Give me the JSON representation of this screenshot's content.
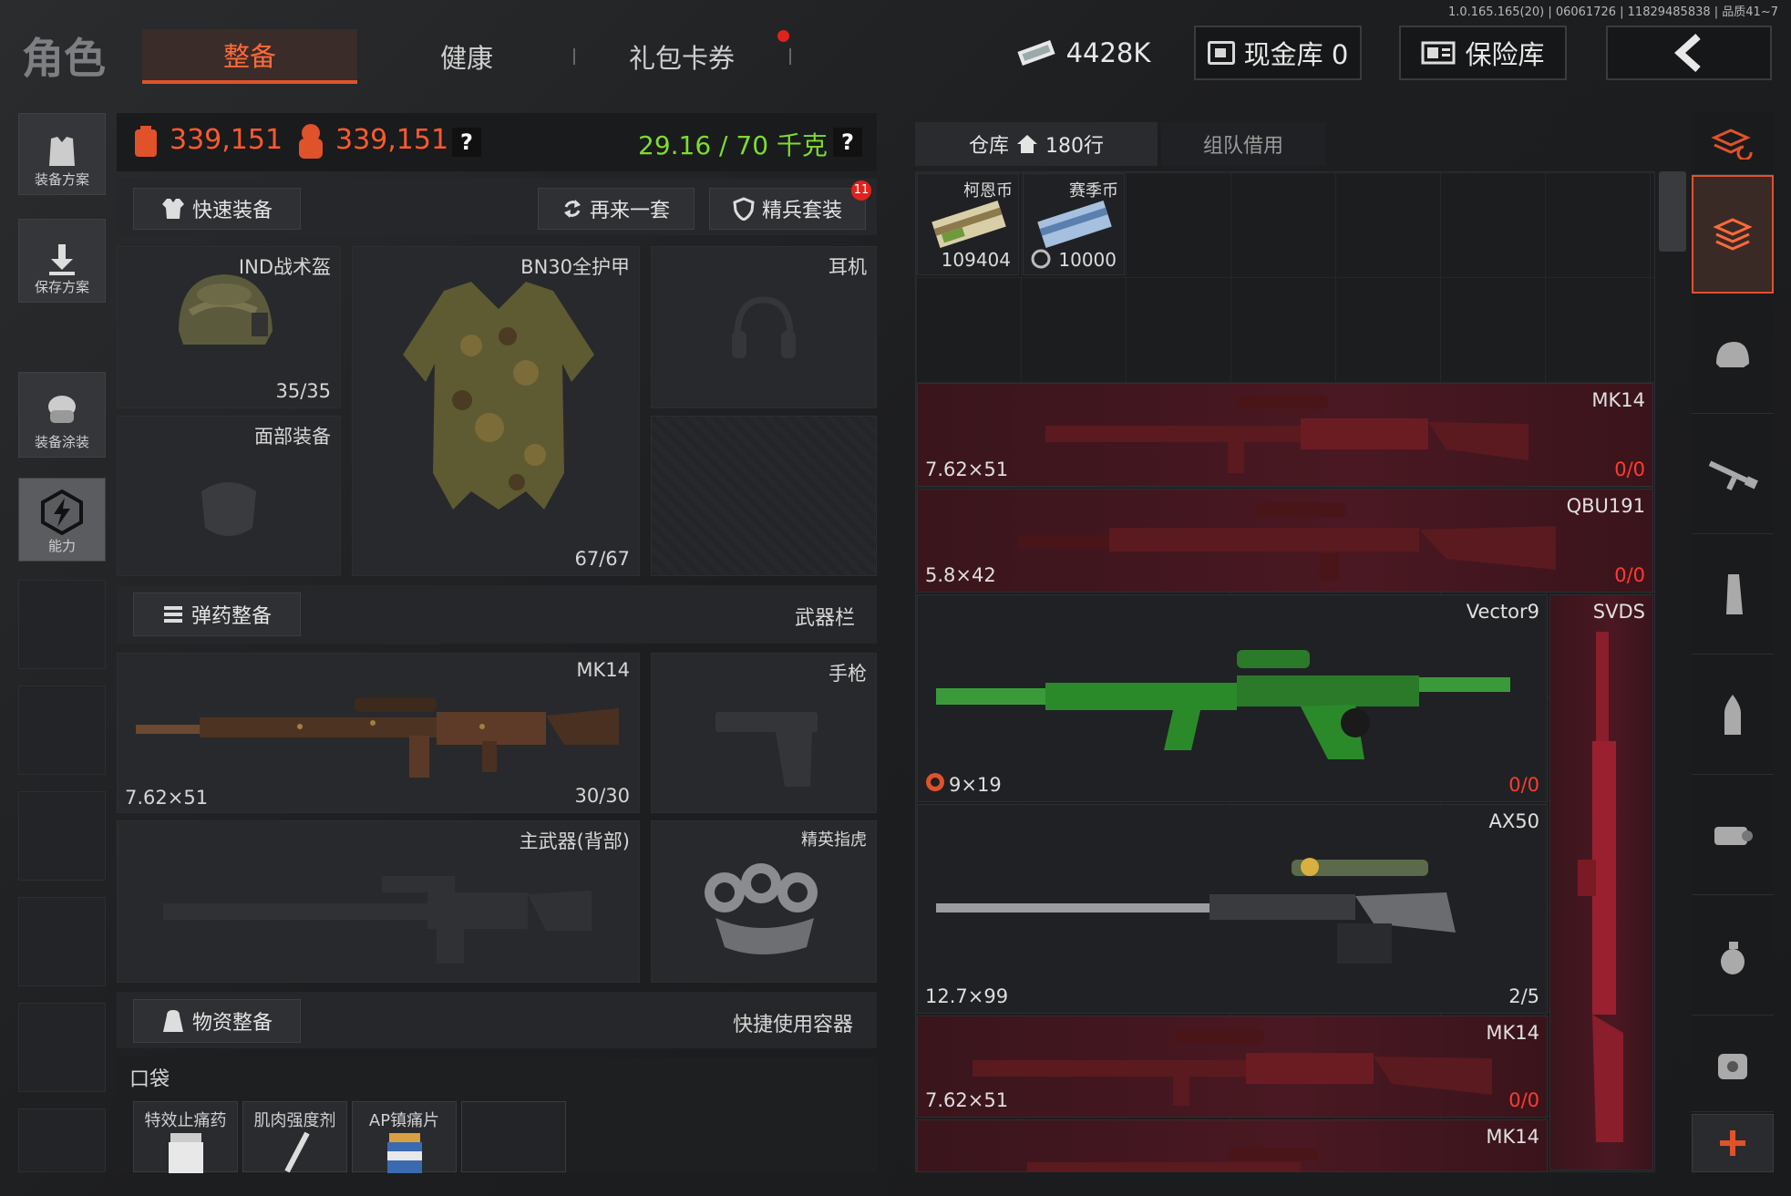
{
  "version": "1.0.165.165(20) | 06061726 | 11829485838 | 品质41~7",
  "header": {
    "title": "角色",
    "tabs": [
      "整备",
      "健康",
      "礼包卡券"
    ],
    "money": "4428K",
    "cash_vault": "现金库 0",
    "safe_box": "保险库"
  },
  "sidebar": {
    "items": [
      "装备方案",
      "保存方案",
      "装备涂装",
      "能力"
    ]
  },
  "stats": {
    "value1": "339,151",
    "value2": "339,151",
    "weight": "29.16 / 70 千克",
    "help": "?"
  },
  "actions": {
    "quick_equip": "快速装备",
    "again": "再来一套",
    "elite": "精兵套装",
    "elite_badge": "11"
  },
  "gear": {
    "helmet": {
      "label": "IND战术盔",
      "value": "35/35"
    },
    "armor": {
      "label": "BN30全护甲",
      "value": "67/67"
    },
    "headset": {
      "label": "耳机"
    },
    "face": {
      "label": "面部装备"
    }
  },
  "ammo": {
    "button": "弹药整备",
    "weapons_label": "武器栏"
  },
  "weapons": {
    "primary": {
      "name": "MK14",
      "caliber": "7.62×51",
      "ammo": "30/30"
    },
    "pistol": {
      "label": "手枪"
    },
    "back": {
      "label": "主武器(背部)"
    },
    "melee": {
      "label": "精英指虎"
    }
  },
  "supplies": {
    "button": "物资整备",
    "quick_use": "快捷使用容器",
    "pocket": "口袋",
    "items": [
      "特效止痛药",
      "肌肉强度剂",
      "AP镇痛片"
    ]
  },
  "warehouse": {
    "tab": "仓库",
    "rows": "180行",
    "team_tab": "组队借用",
    "currency": [
      {
        "name": "柯恩币",
        "amount": "109404"
      },
      {
        "name": "赛季币",
        "amount": "10000"
      }
    ],
    "cards": [
      {
        "name": "MK14",
        "caliber": "7.62×51",
        "count": "0/0"
      },
      {
        "name": "QBU191",
        "caliber": "5.8×42",
        "count": "0/0"
      },
      {
        "name": "Vector9",
        "caliber": "9×19",
        "count": "0/0"
      },
      {
        "name": "SVDS"
      },
      {
        "name": "AX50",
        "caliber": "12.7×99",
        "count": "2/5"
      },
      {
        "name": "MK14",
        "caliber": "7.62×51",
        "count": "0/0"
      },
      {
        "name": "MK14"
      }
    ]
  },
  "colors": {
    "accent": "#e0522a",
    "red": "#ff3b30",
    "green": "#7ddc2e"
  }
}
